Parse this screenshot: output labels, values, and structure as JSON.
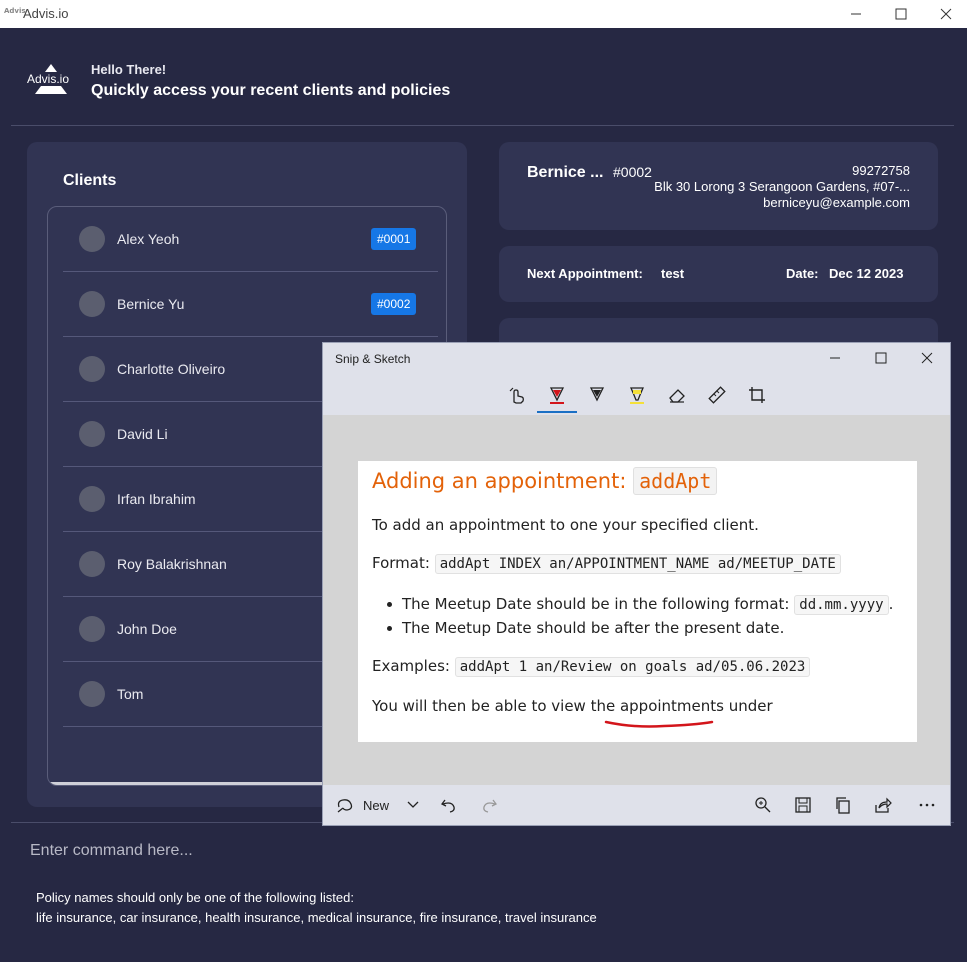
{
  "window": {
    "title": "Advis.io",
    "logo_text": "Advis"
  },
  "header": {
    "logo_text": "Advis.io",
    "greeting": "Hello There!",
    "subtitle": "Quickly access your recent clients and policies"
  },
  "clients": {
    "title": "Clients",
    "items": [
      {
        "name": "Alex Yeoh",
        "badge": "#0001"
      },
      {
        "name": "Bernice Yu",
        "badge": "#0002"
      },
      {
        "name": "Charlotte Oliveiro",
        "badge": ""
      },
      {
        "name": "David Li",
        "badge": ""
      },
      {
        "name": "Irfan Ibrahim",
        "badge": ""
      },
      {
        "name": "Roy Balakrishnan",
        "badge": ""
      },
      {
        "name": "John Doe",
        "badge": ""
      },
      {
        "name": "Tom",
        "badge": ""
      }
    ]
  },
  "client_detail": {
    "name": "Bernice ...",
    "id": "#0002",
    "phone": "99272758",
    "address": "Blk 30 Lorong 3 Serangoon Gardens, #07-...",
    "email": "berniceyu@example.com"
  },
  "appointment": {
    "label": "Next Appointment:",
    "value": "test",
    "date_label": "Date:",
    "date_value": "Dec 12 2023"
  },
  "command": {
    "placeholder": "Enter command here..."
  },
  "policy_note": {
    "line1": "Policy names should only be one of the following listed:",
    "line2": "life insurance, car insurance, health insurance, medical insurance, fire insurance, travel insurance"
  },
  "snip": {
    "title": "Snip & Sketch",
    "new_label": "New",
    "doc": {
      "heading": "Adding an appointment:",
      "heading_code": "addApt",
      "intro": "To add an appointment to one your specified client.",
      "format_label": "Format:",
      "format_code": "addApt INDEX an/APPOINTMENT_NAME ad/MEETUP_DATE",
      "bullet1": "The Meetup Date should be in the following format:",
      "bullet1_code": "dd.mm.yyyy",
      "bullet1_end": ".",
      "bullet2": "The Meetup Date should be after the present date.",
      "examples_label": "Examples:",
      "examples_code": "addApt 1 an/Review on goals ad/05.06.2023",
      "last_line": "You will then be able to view the appointments under"
    }
  },
  "colors": {
    "background": "#262843",
    "panel": "#313453",
    "badge": "#1677e6",
    "heading_orange": "#e36209",
    "annotation_red": "#d3151b"
  }
}
